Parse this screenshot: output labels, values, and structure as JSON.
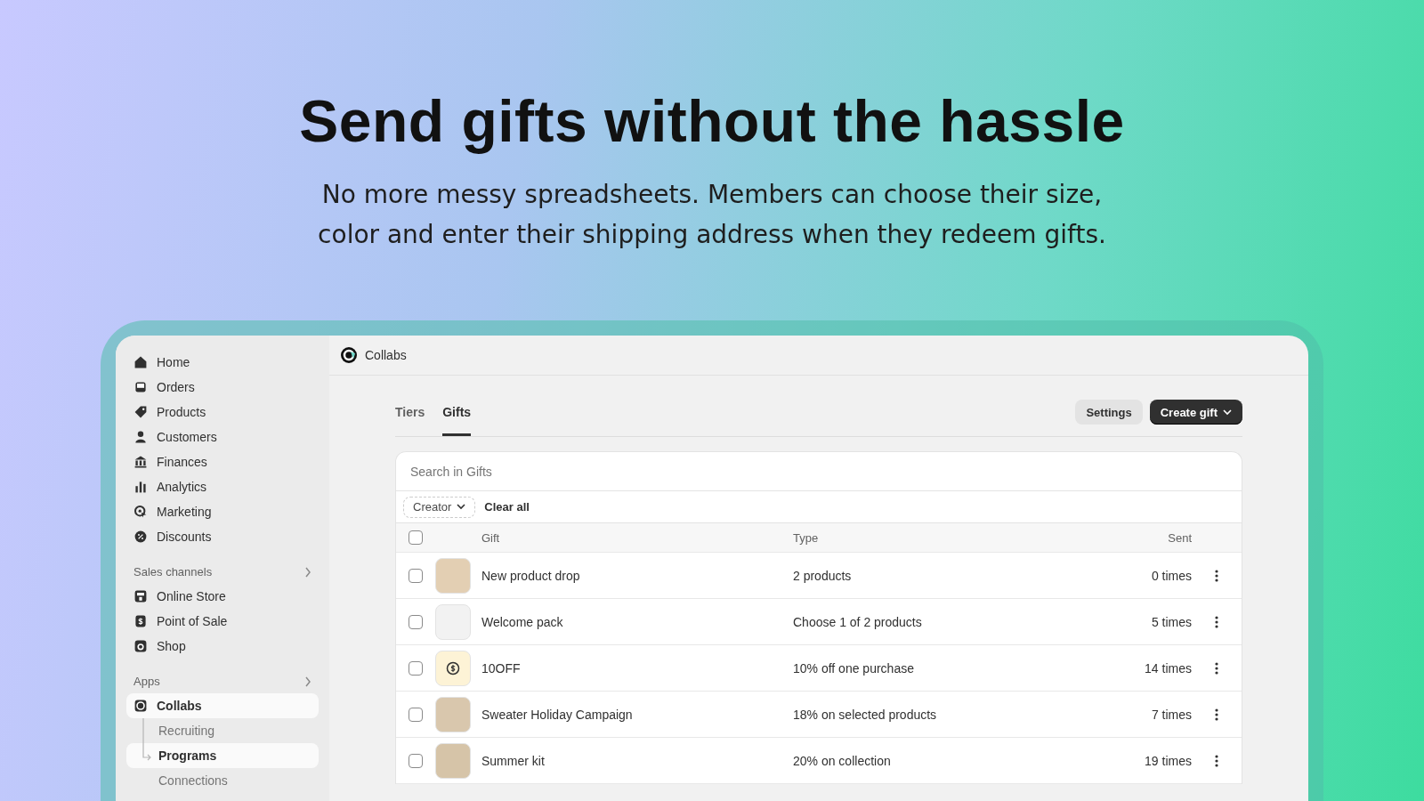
{
  "hero": {
    "title": "Send gifts without the hassle",
    "subtitle": "No more messy spreadsheets. Members can choose their size, color and enter their shipping address when they redeem gifts."
  },
  "sidebar": {
    "items": [
      {
        "label": "Home",
        "selected": false
      },
      {
        "label": "Orders",
        "selected": false
      },
      {
        "label": "Products",
        "selected": false
      },
      {
        "label": "Customers",
        "selected": false
      },
      {
        "label": "Finances",
        "selected": false
      },
      {
        "label": "Analytics",
        "selected": false
      },
      {
        "label": "Marketing",
        "selected": false
      },
      {
        "label": "Discounts",
        "selected": false
      }
    ],
    "sections": [
      {
        "heading": "Sales channels",
        "items": [
          {
            "label": "Online Store",
            "selected": false
          },
          {
            "label": "Point of Sale",
            "selected": false
          },
          {
            "label": "Shop",
            "selected": false
          }
        ]
      },
      {
        "heading": "Apps",
        "items": [
          {
            "label": "Collabs",
            "selected": true,
            "children": [
              {
                "label": "Recruiting",
                "selected": false
              },
              {
                "label": "Programs",
                "selected": true
              },
              {
                "label": "Connections",
                "selected": false
              }
            ]
          }
        ]
      }
    ]
  },
  "app_header": {
    "title": "Collabs"
  },
  "tabs": [
    {
      "label": "Tiers",
      "selected": false
    },
    {
      "label": "Gifts",
      "selected": true
    }
  ],
  "buttons": {
    "secondary": "Settings",
    "primary": "Create gift"
  },
  "search": {
    "placeholder": "Search in Gifts"
  },
  "filters": {
    "chip": "Creator",
    "clear": "Clear all"
  },
  "table": {
    "columns": [
      "Gift",
      "Type",
      "Sent"
    ],
    "header_checked": false,
    "rows": [
      {
        "kind": "photo",
        "color": "#e3cfb3",
        "name": "New product drop",
        "type": "2 products",
        "sent": "0 times",
        "checked": false
      },
      {
        "kind": "photo",
        "color": "#f2f2f2",
        "name": "Welcome pack",
        "type": "Choose 1 of 2 products",
        "sent": "5 times",
        "checked": false
      },
      {
        "kind": "discount",
        "color": "#fdf3d6",
        "name": "10OFF",
        "type": "10% off one purchase",
        "sent": "14 times",
        "checked": false
      },
      {
        "kind": "photo",
        "color": "#d9c7ad",
        "name": "Sweater Holiday Campaign",
        "type": "18% on selected products",
        "sent": "7 times",
        "checked": false
      },
      {
        "kind": "photo",
        "color": "#d6c4a8",
        "name": "Summer kit",
        "type": "20% on collection",
        "sent": "19 times",
        "checked": false
      }
    ]
  }
}
